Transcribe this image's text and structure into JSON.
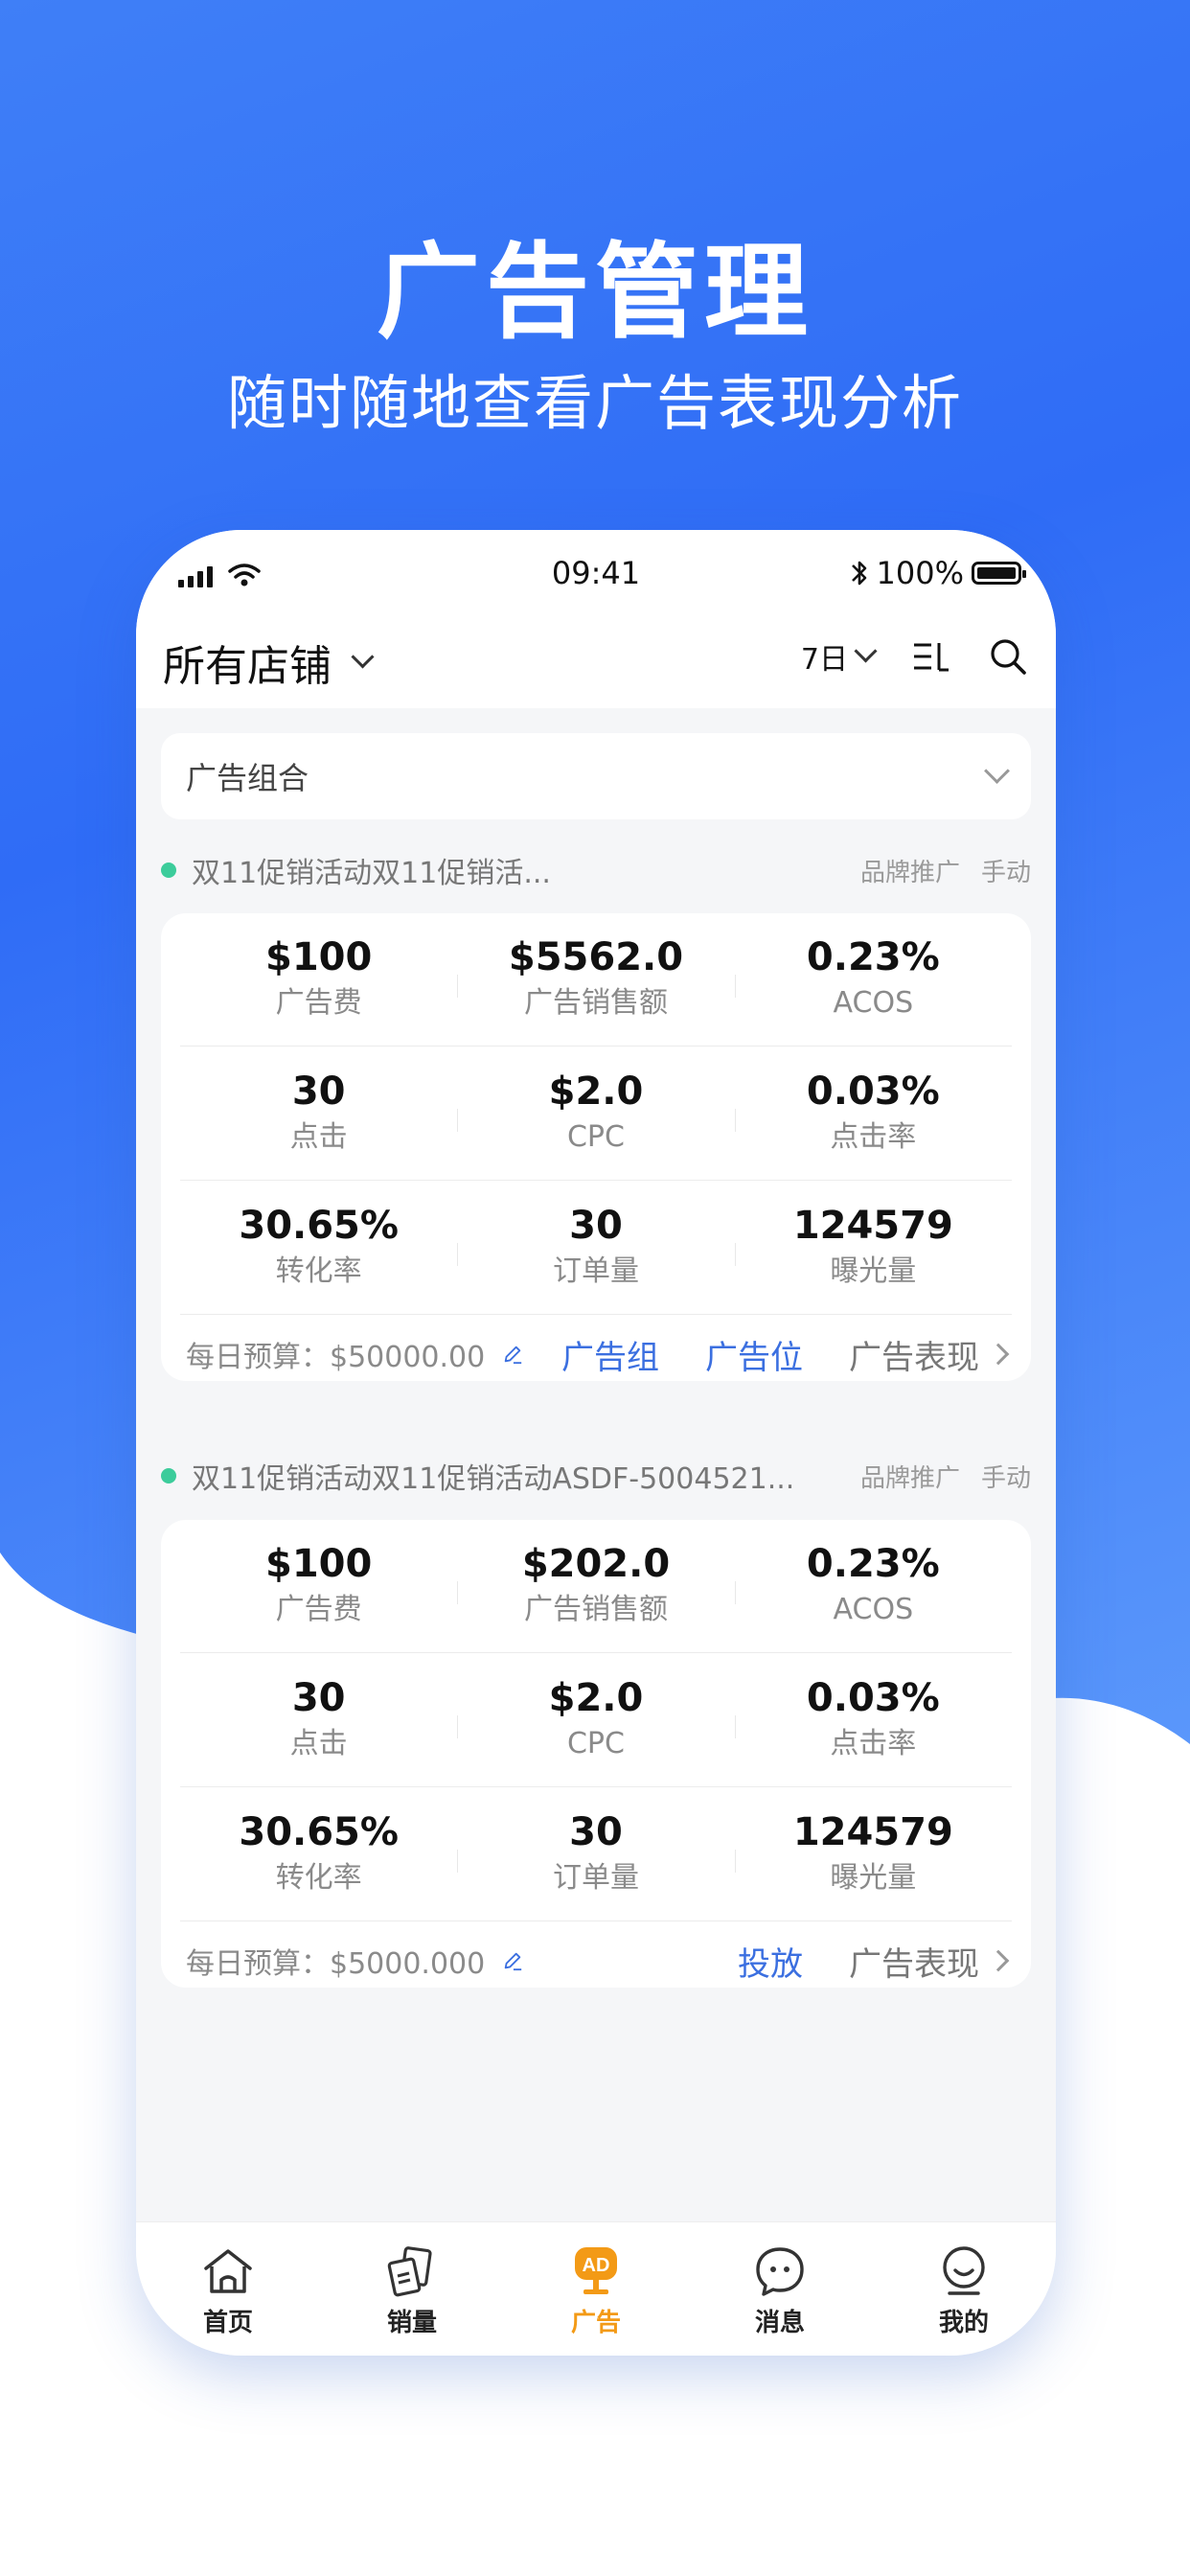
{
  "promo": {
    "title": "广告管理",
    "subtitle": "随时随地查看广告表现分析"
  },
  "status_bar": {
    "time": "09:41",
    "battery": "100%"
  },
  "header": {
    "store_label": "所有店铺",
    "range_label": "7日",
    "filter_icon": "filter-lines-icon",
    "search_icon": "search-icon"
  },
  "filter": {
    "label": "广告组合"
  },
  "campaigns": [
    {
      "name": "双11促销活动双11促销活...",
      "tag_type": "品牌推广",
      "tag_mode": "手动",
      "metrics": [
        [
          {
            "value": "$100",
            "label": "广告费"
          },
          {
            "value": "$5562.0",
            "label": "广告销售额"
          },
          {
            "value": "0.23%",
            "label": "ACOS"
          }
        ],
        [
          {
            "value": "30",
            "label": "点击"
          },
          {
            "value": "$2.0",
            "label": "CPC"
          },
          {
            "value": "0.03%",
            "label": "点击率"
          }
        ],
        [
          {
            "value": "30.65%",
            "label": "转化率"
          },
          {
            "value": "30",
            "label": "订单量"
          },
          {
            "value": "124579",
            "label": "曝光量"
          }
        ]
      ],
      "budget": "每日预算：$50000.00",
      "link1": "广告组",
      "link2": "广告位",
      "link_perf": "广告表现"
    },
    {
      "name": "双11促销活动双11促销活动ASDF-5004521...",
      "tag_type": "品牌推广",
      "tag_mode": "手动",
      "metrics": [
        [
          {
            "value": "$100",
            "label": "广告费"
          },
          {
            "value": "$202.0",
            "label": "广告销售额"
          },
          {
            "value": "0.23%",
            "label": "ACOS"
          }
        ],
        [
          {
            "value": "30",
            "label": "点击"
          },
          {
            "value": "$2.0",
            "label": "CPC"
          },
          {
            "value": "0.03%",
            "label": "点击率"
          }
        ],
        [
          {
            "value": "30.65%",
            "label": "转化率"
          },
          {
            "value": "30",
            "label": "订单量"
          },
          {
            "value": "124579",
            "label": "曝光量"
          }
        ]
      ],
      "budget": "每日预算：$5000.000",
      "link1": "投放",
      "link_perf": "广告表现"
    }
  ],
  "tabbar": [
    {
      "label": "首页",
      "icon": "home-icon"
    },
    {
      "label": "销量",
      "icon": "sales-icon"
    },
    {
      "label": "广告",
      "icon": "ad-icon",
      "badge": "AD",
      "active": true
    },
    {
      "label": "消息",
      "icon": "message-icon"
    },
    {
      "label": "我的",
      "icon": "profile-icon"
    }
  ],
  "colors": {
    "brand_blue": "#2f6cf6",
    "link_blue": "#3b6fe0",
    "active_orange": "#f39a16",
    "status_green": "#3ccc9b"
  }
}
